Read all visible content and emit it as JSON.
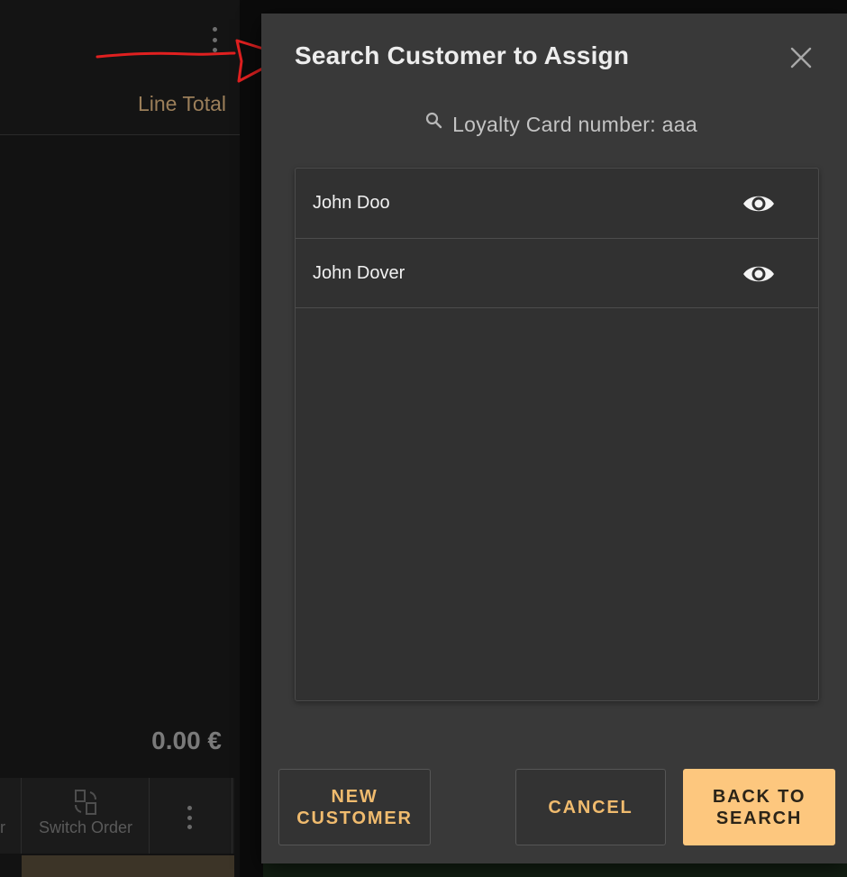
{
  "background": {
    "line_total_label": "Line Total",
    "total_amount": "0.00 €",
    "partial_letter": "r",
    "switch_order_label": "Switch Order"
  },
  "dialog": {
    "title": "Search Customer to Assign",
    "search_query": "Loyalty Card number: aaa",
    "results": [
      {
        "name": "John Doo"
      },
      {
        "name": "John Dover"
      }
    ],
    "buttons": {
      "new_customer": "NEW CUSTOMER",
      "cancel": "CANCEL",
      "back_to_search": "BACK TO SEARCH"
    }
  },
  "colors": {
    "accent": "#f0bb6e",
    "primary_button": "#fdc77e",
    "annotation": "#e02020",
    "dialog_background": "#393939"
  },
  "icons": {
    "close": "close-icon",
    "search": "search-icon",
    "view": "eye-icon",
    "menu": "kebab-menu-icon",
    "switch_order": "switch-order-icon"
  }
}
